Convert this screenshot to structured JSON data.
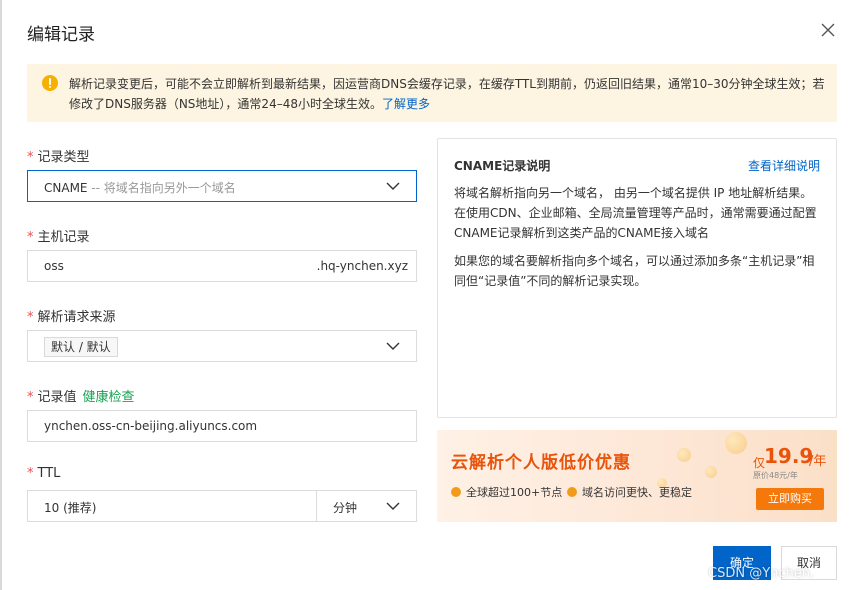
{
  "dialog": {
    "title": "编辑记录"
  },
  "notice": {
    "text": "解析记录变更后，可能不会立即解析到最新结果，因运营商DNS会缓存记录，在缓存TTL到期前，仍返回旧结果，通常10–30分钟全球生效；若修改了DNS服务器（NS地址），通常24–48小时全球生效。",
    "link": "了解更多"
  },
  "form": {
    "record_type": {
      "label": "记录类型",
      "value": "CNAME",
      "hint": "-- 将域名指向另外一个域名"
    },
    "host": {
      "label": "主机记录",
      "value": "oss",
      "suffix": ".hq-ynchen.xyz"
    },
    "source": {
      "label": "解析请求来源",
      "value": "默认 / 默认"
    },
    "record_value": {
      "label": "记录值",
      "health_check": "健康检查",
      "value": "ynchen.oss-cn-beijing.aliyuncs.com"
    },
    "ttl": {
      "label": "TTL",
      "value": "10 (推荐)",
      "unit": "分钟"
    }
  },
  "info": {
    "title": "CNAME记录说明",
    "link": "查看详细说明",
    "para1": "将域名解析指向另一个域名， 由另一个域名提供 IP 地址解析结果。在使用CDN、企业邮箱、全局流量管理等产品时，通常需要通过配置CNAME记录解析到这类产品的CNAME接入域名",
    "para2": "如果您的域名要解析指向多个域名，可以通过添加多条“主机记录”相同但“记录值”不同的解析记录实现。"
  },
  "promo": {
    "title": "云解析个人版低价优惠",
    "feature1": "全球超过100+节点",
    "feature2": "域名访问更快、更稳定",
    "price_prefix": "仅",
    "price": "19.9",
    "price_unit": "/年",
    "original_price": "原价48元/年",
    "buy": "立即购买"
  },
  "footer": {
    "ok": "确定",
    "cancel": "取消"
  },
  "watermark": "CSDN @Ynchen.",
  "colors": {
    "primary": "#0064c8",
    "notice_bg": "#fdf5e1",
    "required": "#e84e4e",
    "health": "#15a351",
    "promo_orange": "#f5780b"
  }
}
